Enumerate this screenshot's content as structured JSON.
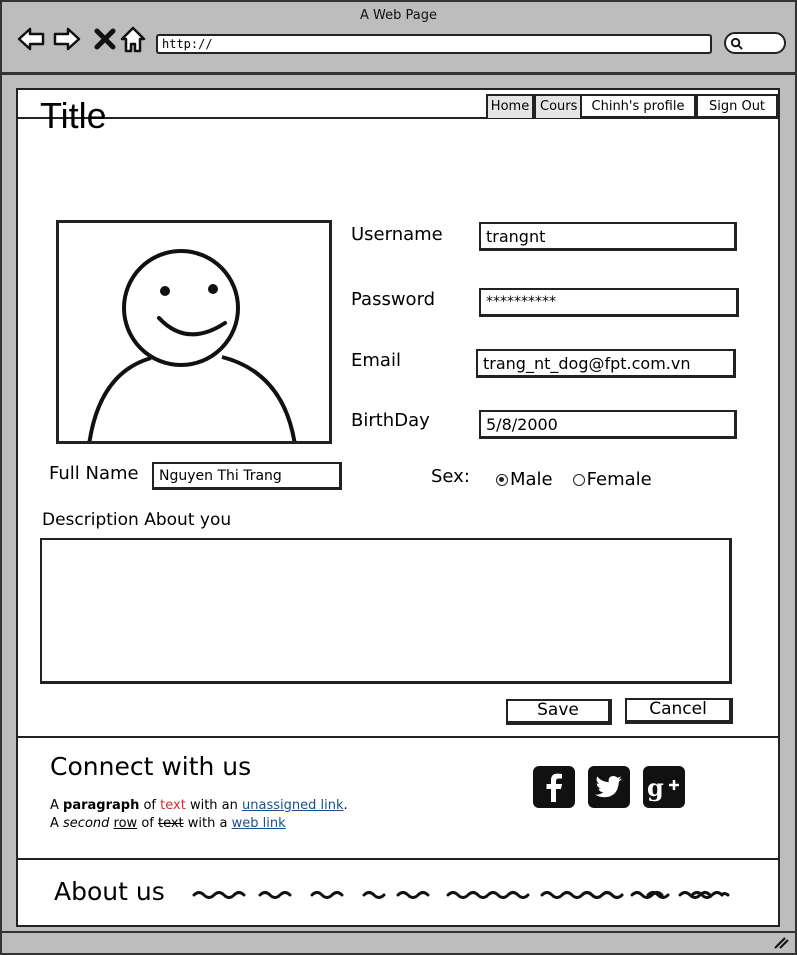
{
  "window": {
    "title": "A Web Page",
    "url": "http://"
  },
  "icons": {
    "back": "arrow-left-icon",
    "forward": "arrow-right-icon",
    "stop": "close-icon",
    "home": "home-icon",
    "search": "search-icon",
    "facebook": "facebook-icon",
    "twitter": "twitter-icon",
    "google_plus": "google-plus-icon"
  },
  "tabs": [
    {
      "label": "Home"
    },
    {
      "label": "Cours"
    },
    {
      "label": "Chinh's profile"
    },
    {
      "label": "Sign Out"
    }
  ],
  "page": {
    "title": "Title"
  },
  "form": {
    "username_label": "Username",
    "username_value": "trangnt",
    "password_label": "Password",
    "password_value": "**********",
    "email_label": "Email",
    "email_value": "trang_nt_dog@fpt.com.vn",
    "birthday_label": "BirthDay",
    "birthday_value": "5/8/2000",
    "fullname_label": "Full Name",
    "fullname_value": "Nguyen Thi Trang",
    "sex_label": "Sex:",
    "sex_options": [
      {
        "label": "Male",
        "checked": true
      },
      {
        "label": "Female",
        "checked": false
      }
    ],
    "description_label": "Description About you",
    "description_value": "",
    "save_label": "Save",
    "cancel_label": "Cancel"
  },
  "footer": {
    "connect_title": "Connect with us",
    "para1": {
      "a": "A ",
      "bold": "paragraph",
      "of": " of ",
      "red": "text",
      "with": " with an ",
      "link": "unassigned link",
      "end": "."
    },
    "para2": {
      "a": "A ",
      "italic": "second",
      "sp": " ",
      "ul": "row",
      "of": " of ",
      "strike": "text",
      "with": " with a ",
      "link": "web link"
    },
    "about_title": "About us"
  }
}
